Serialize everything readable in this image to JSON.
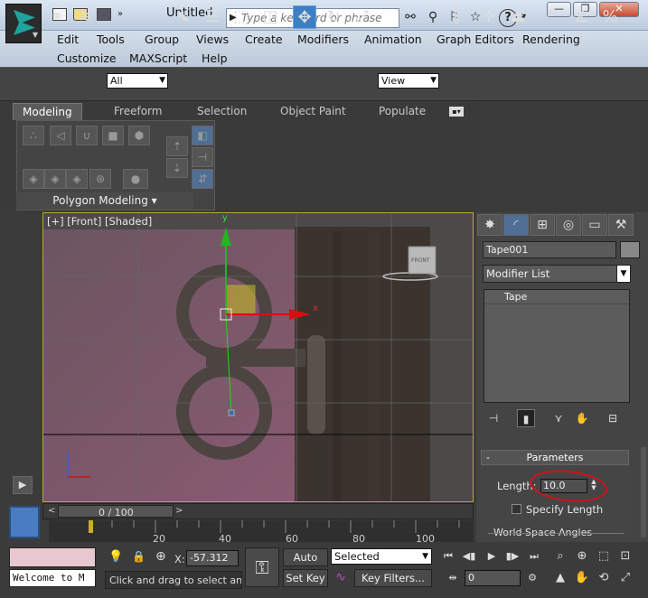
{
  "app": {
    "title": "Untitled",
    "search_placeholder": "Type a keyword or phrase",
    "help_label": "?",
    "window_buttons": [
      "—",
      "❐",
      "✕"
    ]
  },
  "menu": {
    "row1": [
      "Edit",
      "Tools",
      "Group",
      "Views",
      "Create",
      "Modifiers",
      "Animation",
      "Graph Editors",
      "Rendering"
    ],
    "row2": [
      "Customize",
      "MAXScript",
      "Help"
    ]
  },
  "toolbar": {
    "selection_filter": "All",
    "ref_coord": "View"
  },
  "ribbon": {
    "tabs": [
      "Modeling",
      "Freeform",
      "Selection",
      "Object Paint",
      "Populate"
    ],
    "active_tab": "Modeling",
    "panel_label": "Polygon Modeling ▾"
  },
  "viewport": {
    "label": "[+] [Front] [Shaded]",
    "gizmo_y": "y",
    "gizmo_x": "x",
    "viewcube_label": "FRONT"
  },
  "command_panel": {
    "object_name": "Tape001",
    "modifier_list": "Modifier List",
    "stack_items": [
      "Tape"
    ],
    "rollout_title": "Parameters",
    "length_label": "Length:",
    "length_value": "10.0",
    "specify_length_label": "Specify Length",
    "world_space_label": "World Space Angles"
  },
  "timeline": {
    "time_label": "0 / 100",
    "ticks": [
      "20",
      "40",
      "60",
      "80",
      "100"
    ]
  },
  "status": {
    "listener_text": "Welcome to M",
    "x_label": "X:",
    "x_value": "-57.312",
    "prompt": "Click and drag to select and mo",
    "auto_key": "Auto Key",
    "set_key": "Set Key",
    "selected": "Selected",
    "key_filters": "Key Filters...",
    "frame_value": "0"
  },
  "colors": {
    "accent_active": "#3c7fc5",
    "viewport_border": "#b8a53a",
    "annotation": "#d4101a",
    "gizmo_x": "#d41010",
    "gizmo_y": "#1fb81f"
  }
}
